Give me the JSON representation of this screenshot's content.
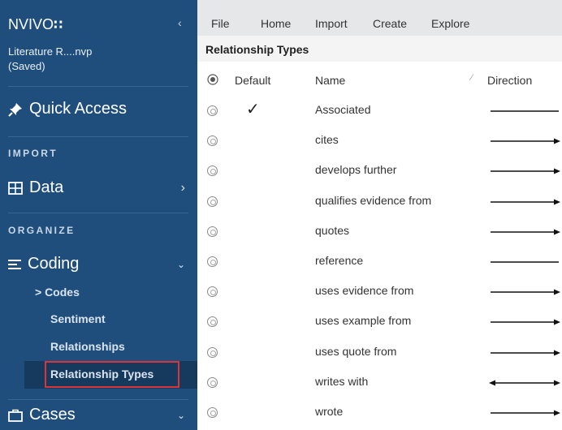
{
  "sidebar": {
    "brand": "NVIVO",
    "brand_mark": "∷",
    "collapse_glyph": "‹",
    "project_name": "Literature R....nvp",
    "project_status": "(Saved)",
    "quick_access": "Quick Access",
    "import_head": "IMPORT",
    "data_label": "Data",
    "organize_head": "ORGANIZE",
    "coding_label": "Coding",
    "codes_label": "> Codes",
    "sentiment_label": "Sentiment",
    "relationships_label": "Relationships",
    "relationship_types_label": "Relationship Types",
    "cases_label": "Cases",
    "accent_highlight": "#d9353a"
  },
  "menu": {
    "items": [
      "File",
      "Home",
      "Import",
      "Create",
      "Explore"
    ]
  },
  "panel": {
    "title": "Relationship Types"
  },
  "table": {
    "headers": {
      "default": "Default",
      "name": "Name",
      "direction": "Direction"
    },
    "sort_glyph": "⁄",
    "rows": [
      {
        "name": "Associated",
        "default": "✓",
        "direction": "none"
      },
      {
        "name": "cites",
        "default": "",
        "direction": "one-way"
      },
      {
        "name": "develops further",
        "default": "",
        "direction": "one-way"
      },
      {
        "name": "qualifies evidence from",
        "default": "",
        "direction": "one-way"
      },
      {
        "name": "quotes",
        "default": "",
        "direction": "one-way"
      },
      {
        "name": "reference",
        "default": "",
        "direction": "none"
      },
      {
        "name": "uses evidence from",
        "default": "",
        "direction": "one-way"
      },
      {
        "name": "uses example from",
        "default": "",
        "direction": "one-way"
      },
      {
        "name": "uses quote from",
        "default": "",
        "direction": "one-way"
      },
      {
        "name": "writes with",
        "default": "",
        "direction": "two-way"
      },
      {
        "name": "wrote",
        "default": "",
        "direction": "one-way"
      }
    ]
  }
}
